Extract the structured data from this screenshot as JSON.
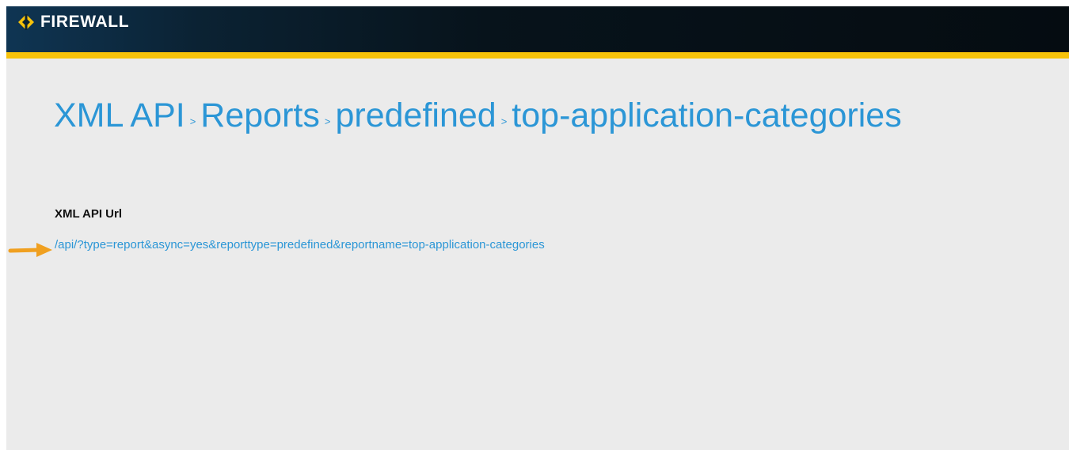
{
  "header": {
    "brand_name": "FIREWALL",
    "logo_icon": "chevron-diamond-icon",
    "accent_color": "#f7c20a",
    "bar_color": "#07131b"
  },
  "breadcrumb": {
    "separator": ">",
    "items": [
      {
        "label": "XML API"
      },
      {
        "label": "Reports"
      },
      {
        "label": "predefined"
      },
      {
        "label": "top-application-categories"
      }
    ],
    "link_color": "#2b96d6"
  },
  "main": {
    "section_label": "XML API Url",
    "api_url": "/api/?type=report&async=yes&reporttype=predefined&reportname=top-application-categories",
    "annotation_icon": "arrow-right-icon",
    "annotation_color": "#f0a020"
  }
}
